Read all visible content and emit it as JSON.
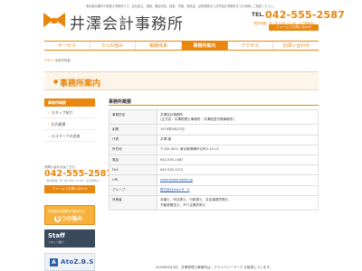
{
  "top_note": "東京都清瀬市の税理士事務所です。会社設立、相続、確定申告、経営、労務、助成金、記帳業務なら井澤会計事務所までお気軽にご相談ください。",
  "header": {
    "logo_text": "井澤会計事務所",
    "tel_label": "TEL.",
    "tel": "042-555-2587",
    "hours": "［受付時間］月〜金 9:00〜17:00（土日祝休み）",
    "form_button": "フォームでお問い合わせ"
  },
  "nav": {
    "items": [
      {
        "label": "サービス"
      },
      {
        "label": "5つの強み"
      },
      {
        "label": "報酬体系"
      },
      {
        "label": "事務所案内",
        "active": true
      },
      {
        "label": "アクセス"
      },
      {
        "label": "お問い合わせ"
      }
    ]
  },
  "breadcrumb": {
    "home": "TOP",
    "sep": ">",
    "current": "事務所概要"
  },
  "page_title": "事務所案内",
  "sidebar": {
    "head": "事務所概要",
    "items": [
      {
        "label": "スタッフ紹介"
      },
      {
        "label": "社内風景"
      },
      {
        "label": "ロゴマークの由来"
      }
    ]
  },
  "side_contact": {
    "label": "お問い合わせはこちら",
    "tel": "042-555-2587",
    "hours": "［受付時間］月〜金 9:00〜17:00（土日祝休み）",
    "button": "フォームでお問い合わせ"
  },
  "banners": {
    "strengths_line1": "井澤会計事務所が選ばれる",
    "strengths_line2_pre": "",
    "strengths_num": "5",
    "strengths_line2_post": "つの強み",
    "staff_title": "Staff",
    "staff_sub": "スタッフ紹介",
    "atoz": "AtoZ.B.S"
  },
  "main": {
    "section_title": "事務所概要",
    "rows": [
      {
        "key": "事務所名",
        "value": "井澤会計事務所\n(正式名：井澤税理士事務所・井澤経営労務事務所)"
      },
      {
        "key": "創業",
        "value": "1974年5月22日"
      },
      {
        "key": "代表",
        "value": "井澤 康"
      },
      {
        "key": "所在地",
        "value": "〒205-0011 東京都清瀬市元町2-19-15"
      },
      {
        "key": "電話",
        "value": "042-555-2587"
      },
      {
        "key": "FAX",
        "value": "042-555-1212"
      },
      {
        "key": "URL",
        "value": "www.izawa-kaikei.jp",
        "link": true
      },
      {
        "key": "グループ",
        "value": "株式会社AtoZ B・S",
        "link": true
      },
      {
        "key": "資格者",
        "value": "弁護士、司法書士、行政書士、社会保険労務士、\n不動産鑑定士、不介企業診断士"
      }
    ]
  },
  "footer_note": "2005年5月3日、井澤税理士事務所は、プライバシーマーク を取得しています。"
}
